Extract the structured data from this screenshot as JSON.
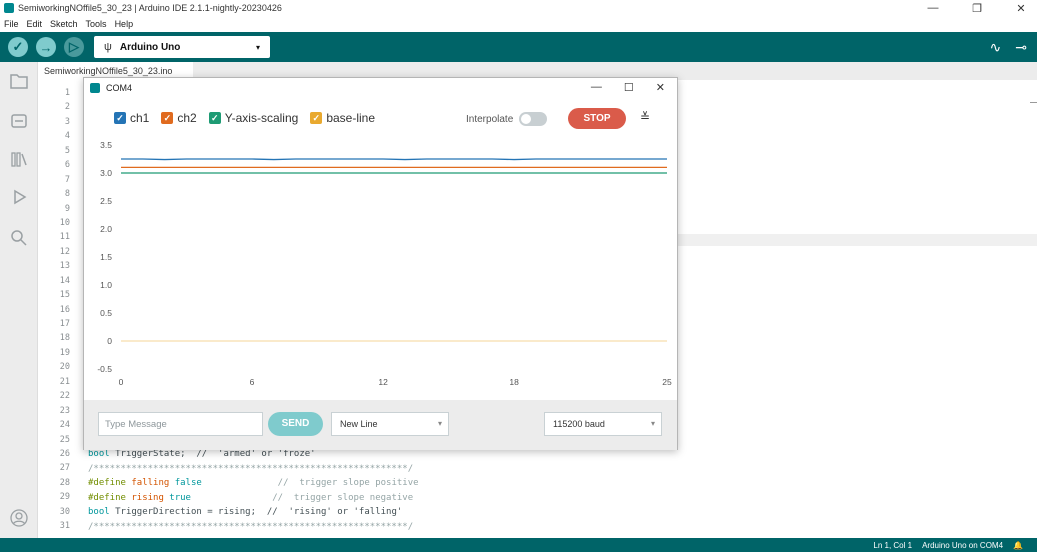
{
  "window": {
    "title": "SemiworkingNOffile5_30_23 | Arduino IDE 2.1.1-nightly-20230426",
    "controls": [
      "—",
      "❐",
      "✕"
    ]
  },
  "menu": [
    "File",
    "Edit",
    "Sketch",
    "Tools",
    "Help"
  ],
  "toolbar": {
    "verify_icon": "✓",
    "upload_icon": "→",
    "debug_icon": "▷",
    "board": "Arduino Uno",
    "usb_icon": "ψ",
    "caret": "▾",
    "plotter_icon": "∿",
    "monitor_icon": "⊸"
  },
  "editor": {
    "tab": "SemiworkingNOffile5_30_23.ino",
    "line_numbers": [
      "1",
      "2",
      "3",
      "4",
      "5",
      "6",
      "7",
      "8",
      "9",
      "10",
      "11",
      "12",
      "13",
      "14",
      "15",
      "16",
      "17",
      "18",
      "19",
      "20",
      "21",
      "22",
      "23",
      "24",
      "25",
      "26",
      "27",
      "28",
      "29",
      "30",
      "31"
    ],
    "code": {
      "l26a": "bool",
      "l26b": " TriggerState;  //  'armed' or 'froze'",
      "l27": "/**********************************************************/",
      "l28a": "#define",
      "l28b": " falling",
      "l28c": " false",
      "l28d": "              //  trigger slope positive",
      "l29a": "#define",
      "l29b": " rising",
      "l29c": " true",
      "l29d": "               //  trigger slope negative",
      "l30a": "bool",
      "l30b": " TriggerDirection = rising;  //  'rising' or 'falling'",
      "l31": "/**********************************************************/"
    }
  },
  "status": {
    "position": "Ln 1, Col 1",
    "board": "Arduino Uno on COM4",
    "bell_icon": "🔔"
  },
  "plotter": {
    "title": "COM4",
    "controls": [
      "—",
      "☐",
      "✕"
    ],
    "legend": [
      {
        "label": "ch1",
        "color": "#2474b5"
      },
      {
        "label": "ch2",
        "color": "#e06b1f"
      },
      {
        "label": "Y-axis-scaling",
        "color": "#1e9b74"
      },
      {
        "label": "base-line",
        "color": "#e9a92f"
      }
    ],
    "interpolate_label": "Interpolate",
    "stop_label": "STOP",
    "clear_icon": "≚",
    "message_placeholder": "Type Message",
    "send_label": "SEND",
    "line_ending": "New Line",
    "baud": "115200 baud"
  },
  "chart_data": {
    "type": "line",
    "x_ticks": [
      "0",
      "6",
      "12",
      "18",
      "25"
    ],
    "y_ticks": [
      "3.5",
      "3.0",
      "2.5",
      "2.0",
      "1.5",
      "1.0",
      "0.5",
      "0",
      "-0.5"
    ],
    "xlim": [
      0,
      25
    ],
    "ylim": [
      -0.5,
      3.5
    ],
    "grid": false,
    "series": [
      {
        "name": "ch1",
        "color": "#2474b5",
        "values": [
          3.25,
          3.25,
          3.24,
          3.25,
          3.25,
          3.25,
          3.25,
          3.24,
          3.25,
          3.25,
          3.25,
          3.25,
          3.25,
          3.24,
          3.25,
          3.25,
          3.25,
          3.25,
          3.24,
          3.25,
          3.25,
          3.25,
          3.25,
          3.25,
          3.25,
          3.25
        ]
      },
      {
        "name": "ch2",
        "color": "#e06b1f",
        "values": [
          3.1,
          3.1,
          3.1,
          3.1,
          3.1,
          3.1,
          3.1,
          3.1,
          3.1,
          3.1,
          3.1,
          3.1,
          3.1,
          3.1,
          3.1,
          3.1,
          3.1,
          3.1,
          3.1,
          3.1,
          3.1,
          3.1,
          3.1,
          3.1,
          3.1,
          3.1
        ]
      },
      {
        "name": "Y-axis-scaling",
        "color": "#1e9b74",
        "values": [
          3.0,
          3.0,
          3.0,
          3.0,
          3.0,
          3.0,
          3.0,
          3.0,
          3.0,
          3.0,
          3.0,
          3.0,
          3.0,
          3.0,
          3.0,
          3.0,
          3.0,
          3.0,
          3.0,
          3.0,
          3.0,
          3.0,
          3.0,
          3.0,
          3.0,
          3.0
        ]
      },
      {
        "name": "base-line",
        "color": "#e9a92f",
        "values": [
          0,
          0,
          0,
          0,
          0,
          0,
          0,
          0,
          0,
          0,
          0,
          0,
          0,
          0,
          0,
          0,
          0,
          0,
          0,
          0,
          0,
          0,
          0,
          0,
          0,
          0
        ]
      }
    ]
  }
}
